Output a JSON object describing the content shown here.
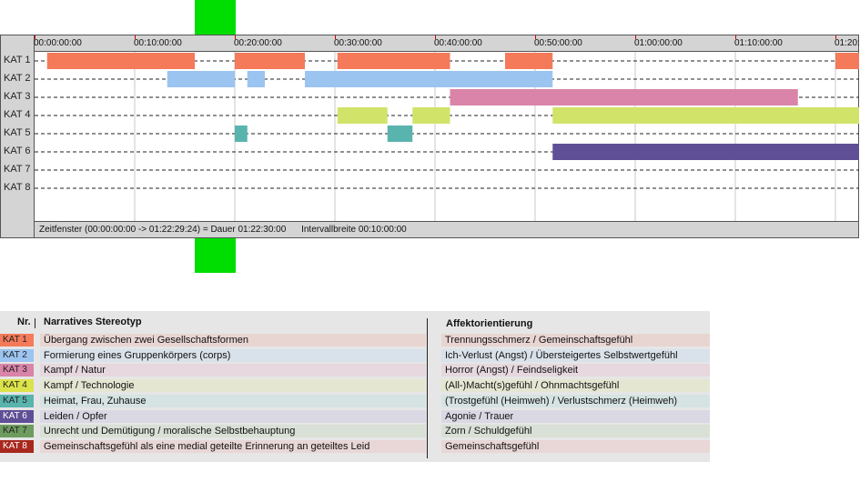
{
  "chart_data": {
    "type": "timeline",
    "x_unit": "time",
    "x_range": [
      "00:00:00:00",
      "01:22:29:24"
    ],
    "tick_labels": [
      "00:00:00:00",
      "00:10:00:00",
      "00:20:00:00",
      "00:30:00:00",
      "00:40:00:00",
      "00:50:00:00",
      "01:00:00:00",
      "01:10:00:00",
      "01:20:00:00"
    ],
    "categories": [
      "KAT 1",
      "KAT 2",
      "KAT 3",
      "KAT 4",
      "KAT 5",
      "KAT 6",
      "KAT 7",
      "KAT 8"
    ],
    "series": [
      {
        "category": "KAT 1",
        "color": "#f47a5a",
        "segments": [
          [
            "00:01:15",
            "00:16:00"
          ],
          [
            "00:20:00",
            "00:27:00"
          ],
          [
            "00:30:15",
            "00:41:30"
          ],
          [
            "00:47:00",
            "00:51:45"
          ],
          [
            "01:20:00",
            "01:22:29"
          ]
        ]
      },
      {
        "category": "KAT 2",
        "color": "#9cc4f0",
        "segments": [
          [
            "00:13:15",
            "00:20:00"
          ],
          [
            "00:21:15",
            "00:23:00"
          ],
          [
            "00:27:00",
            "00:51:45"
          ]
        ]
      },
      {
        "category": "KAT 3",
        "color": "#d984a8",
        "segments": [
          [
            "00:41:30",
            "01:16:15"
          ]
        ]
      },
      {
        "category": "KAT 4",
        "color": "#d2e36a",
        "segments": [
          [
            "00:30:15",
            "00:35:15"
          ],
          [
            "00:37:45",
            "00:41:30"
          ],
          [
            "00:51:45",
            "01:22:29"
          ]
        ]
      },
      {
        "category": "KAT 5",
        "color": "#5ab4ae",
        "segments": [
          [
            "00:20:00",
            "00:21:15"
          ],
          [
            "00:35:15",
            "00:37:45"
          ]
        ]
      },
      {
        "category": "KAT 6",
        "color": "#5f4f96",
        "segments": [
          [
            "00:51:45",
            "01:22:29"
          ]
        ]
      },
      {
        "category": "KAT 7",
        "color": "#6e9c5f",
        "segments": []
      },
      {
        "category": "KAT 8",
        "color": "#a8281e",
        "segments": []
      }
    ],
    "footer": {
      "window": "Zeitfenster (00:00:00:00 -> 01:22:29:24) = Dauer 01:22:30:00",
      "interval": "Intervallbreite 00:10:00:00"
    }
  },
  "legend": {
    "headers": {
      "nr": "Nr.",
      "stereotype": "Narratives Stereotyp",
      "affect": "Affektorientierung"
    },
    "rows": [
      {
        "nr": "KAT 1",
        "color": "#f47a5a",
        "row_color": "#e8d5d2",
        "stereotype": "Übergang zwischen zwei Gesellschaftsformen",
        "affect": "Trennungsschmerz / Gemeinschaftsgefühl"
      },
      {
        "nr": "KAT 2",
        "color": "#9cc4f0",
        "row_color": "#d9e1ea",
        "stereotype": "Formierung eines Gruppenkörpers (corps)",
        "affect": "Ich-Verlust (Angst) / Übersteigertes Selbstwertgefühl"
      },
      {
        "nr": "KAT 3",
        "color": "#d984a8",
        "row_color": "#e6d8de",
        "stereotype": "Kampf / Natur",
        "affect": "Horror (Angst) / Feindseligkeit"
      },
      {
        "nr": "KAT 4",
        "color": "#dce34a",
        "row_color": "#e5e6d2",
        "stereotype": "Kampf / Technologie",
        "affect": "(All-)Macht(s)gefühl / Ohnmachtsgefühl"
      },
      {
        "nr": "KAT 5",
        "color": "#5ab4ae",
        "row_color": "#d5e3e2",
        "stereotype": "Heimat, Frau, Zuhause",
        "affect": "(Trostgefühl (Heimweh) / Verlustschmerz (Heimweh)"
      },
      {
        "nr": "KAT 6",
        "color": "#5f4f96",
        "row_color": "#dad8e3",
        "stereotype": "Leiden / Opfer",
        "affect": "Agonie / Trauer"
      },
      {
        "nr": "KAT 7",
        "color": "#6e9c5f",
        "row_color": "#d9e0d5",
        "stereotype": "Unrecht und Demütigung / moralische Selbstbehauptung",
        "affect": "Zorn / Schuldgefühl"
      },
      {
        "nr": "KAT 8",
        "color": "#a8281e",
        "row_color": "#e8d7d6",
        "stereotype": "Gemeinschaftsgefühl als eine medial geteilte Erinnerung an geteiltes Leid",
        "affect": "Gemeinschaftsgefühl"
      }
    ]
  }
}
